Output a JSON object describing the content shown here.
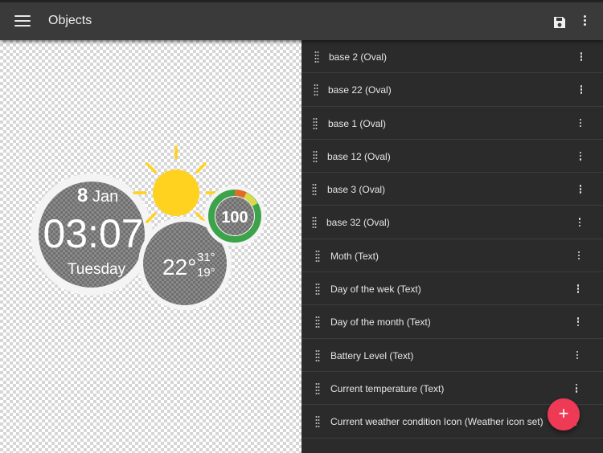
{
  "app": {
    "title": "Objects"
  },
  "toolbar": {
    "menu_icon": "hamburger-menu-icon",
    "save_icon": "floppy-save-icon",
    "overflow_icon": "vertical-ellipsis-icon"
  },
  "watch_preview": {
    "day": "8",
    "month": "Jan",
    "time": "03:07",
    "weekday": "Tuesday",
    "temperature": "22°",
    "high": "31°",
    "low": "19°",
    "battery": "100",
    "weather_icon": "sun-icon",
    "colors": {
      "sun": "#ffd21f",
      "dial_gray": "#7a7a7a",
      "ring_white": "#f5f5f5"
    }
  },
  "objects": [
    {
      "label": "base 2 (Oval)"
    },
    {
      "label": "base 22 (Oval)"
    },
    {
      "label": "base 1 (Oval)"
    },
    {
      "label": "base 12 (Oval)"
    },
    {
      "label": "base 3 (Oval)"
    },
    {
      "label": "base 32 (Oval)"
    },
    {
      "label": "Moth (Text)"
    },
    {
      "label": "Day of the wek (Text)"
    },
    {
      "label": "Day of the month (Text)"
    },
    {
      "label": "Battery Level (Text)"
    },
    {
      "label": "Current temperature (Text)"
    },
    {
      "label": "Current weather condition Icon (Weather icon set)"
    }
  ],
  "fab": {
    "label": "+",
    "icon": "plus-icon",
    "color": "#ef3a55"
  }
}
